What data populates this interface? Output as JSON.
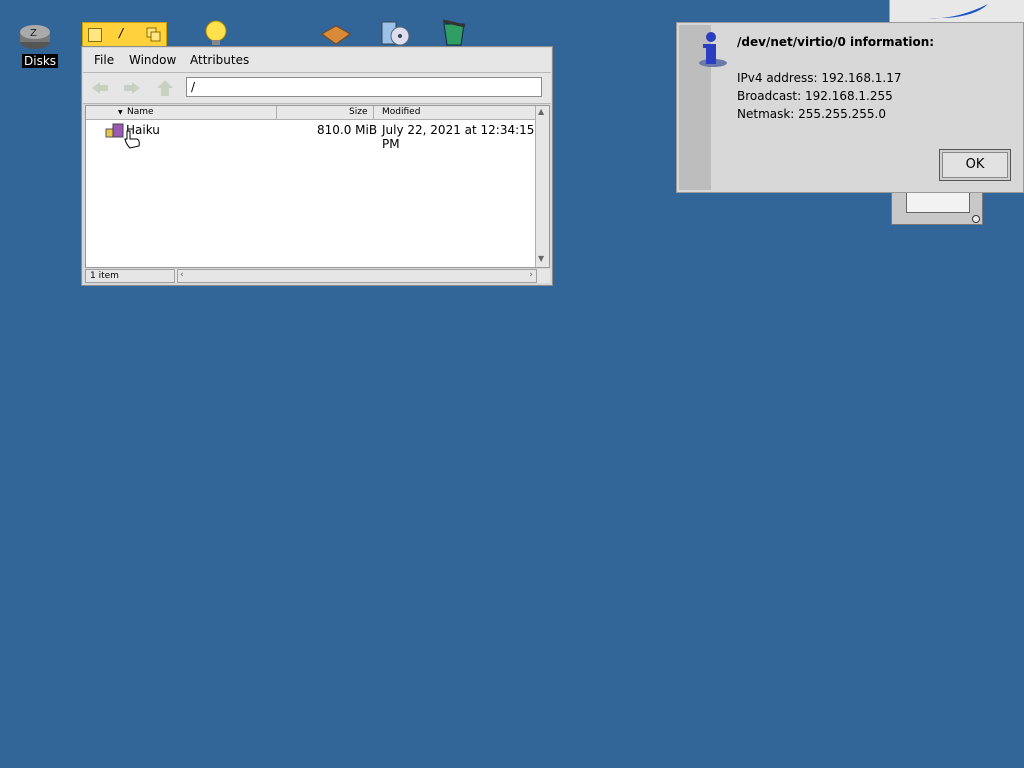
{
  "desktop": {
    "icons": [
      {
        "label": "Disks",
        "icon": "disks-icon"
      }
    ]
  },
  "tracker": {
    "tab_glyph": "/",
    "menu": [
      "File",
      "Window",
      "Attributes"
    ],
    "path": "/",
    "columns": {
      "name": "Name",
      "size": "Size",
      "modified": "Modified"
    },
    "rows": [
      {
        "name": "Haiku",
        "size": "810.0 MiB",
        "modified": "July 22, 2021 at 12:34:15 PM"
      }
    ],
    "status": "1 item"
  },
  "alert": {
    "title": "/dev/net/virtio/0 information:",
    "lines": [
      "IPv4 address: 192.168.1.17",
      "Broadcast: 192.168.1.255",
      "Netmask: 255.255.255.0"
    ],
    "ok_label": "OK"
  },
  "colors": {
    "desktop": "#336698",
    "tab": "#ffd23c",
    "window": "#d8d8d8"
  }
}
